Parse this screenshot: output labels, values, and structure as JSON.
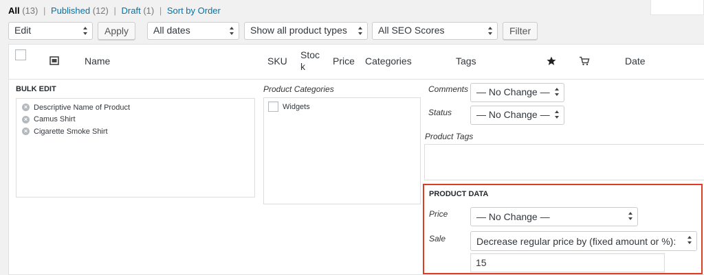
{
  "filters": {
    "all_label": "All",
    "all_count": "(13)",
    "published_label": "Published",
    "published_count": "(12)",
    "draft_label": "Draft",
    "draft_count": "(1)",
    "sort_label": "Sort by Order",
    "separator": "|"
  },
  "toolbar": {
    "bulk_action": "Edit",
    "apply_label": "Apply",
    "dates": "All dates",
    "product_types": "Show all product types",
    "seo_scores": "All SEO Scores",
    "filter_label": "Filter"
  },
  "columns": {
    "name": "Name",
    "sku": "SKU",
    "stock_line1": "Stoc",
    "stock_line2": "k",
    "price": "Price",
    "categories": "Categories",
    "tags": "Tags",
    "featured_icon": "star-icon",
    "type_icon": "cart-icon",
    "thumb_icon": "image-icon",
    "date": "Date"
  },
  "bulk_edit": {
    "title": "BULK EDIT",
    "items": [
      "Descriptive Name of Product",
      "Camus Shirt",
      "Cigarette Smoke Shirt"
    ],
    "remove_icon": "remove-circle-icon"
  },
  "product_categories": {
    "label": "Product Categories",
    "items": [
      "Widgets"
    ]
  },
  "fields": {
    "comments_label": "Comments",
    "comments_value": "— No Change —",
    "status_label": "Status",
    "status_value": "— No Change —",
    "tags_label": "Product Tags"
  },
  "product_data": {
    "title": "PRODUCT DATA",
    "price_label": "Price",
    "price_value": "— No Change —",
    "sale_label": "Sale",
    "sale_value": "Decrease regular price by (fixed amount or %):",
    "sale_amount": "15"
  },
  "colors": {
    "link": "#0073aa",
    "highlight_border": "#e03a23",
    "background": "#f1f1f1"
  }
}
